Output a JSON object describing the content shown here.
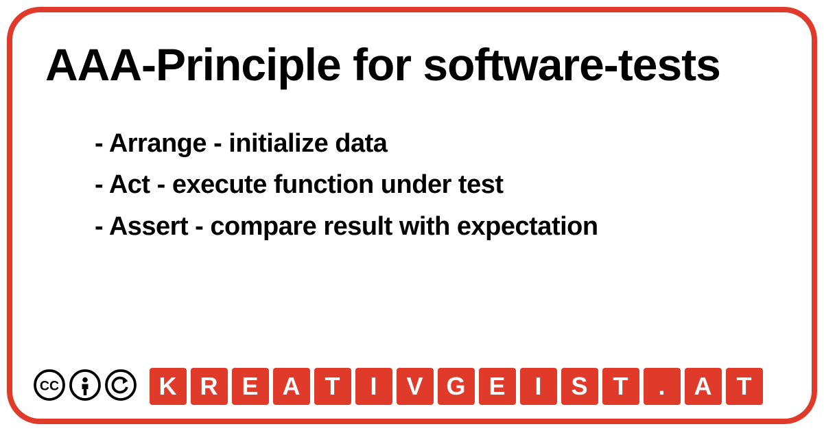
{
  "title": "AAA-Principle for software-tests",
  "items": [
    "Arrange - initialize data",
    "Act - execute function under test",
    "Assert - compare result with expectation"
  ],
  "domain_letters": [
    "K",
    "R",
    "E",
    "A",
    "T",
    "I",
    "V",
    "G",
    "E",
    "I",
    "S",
    "T",
    ".",
    "A",
    "T"
  ],
  "license": "CC-BY-SA"
}
